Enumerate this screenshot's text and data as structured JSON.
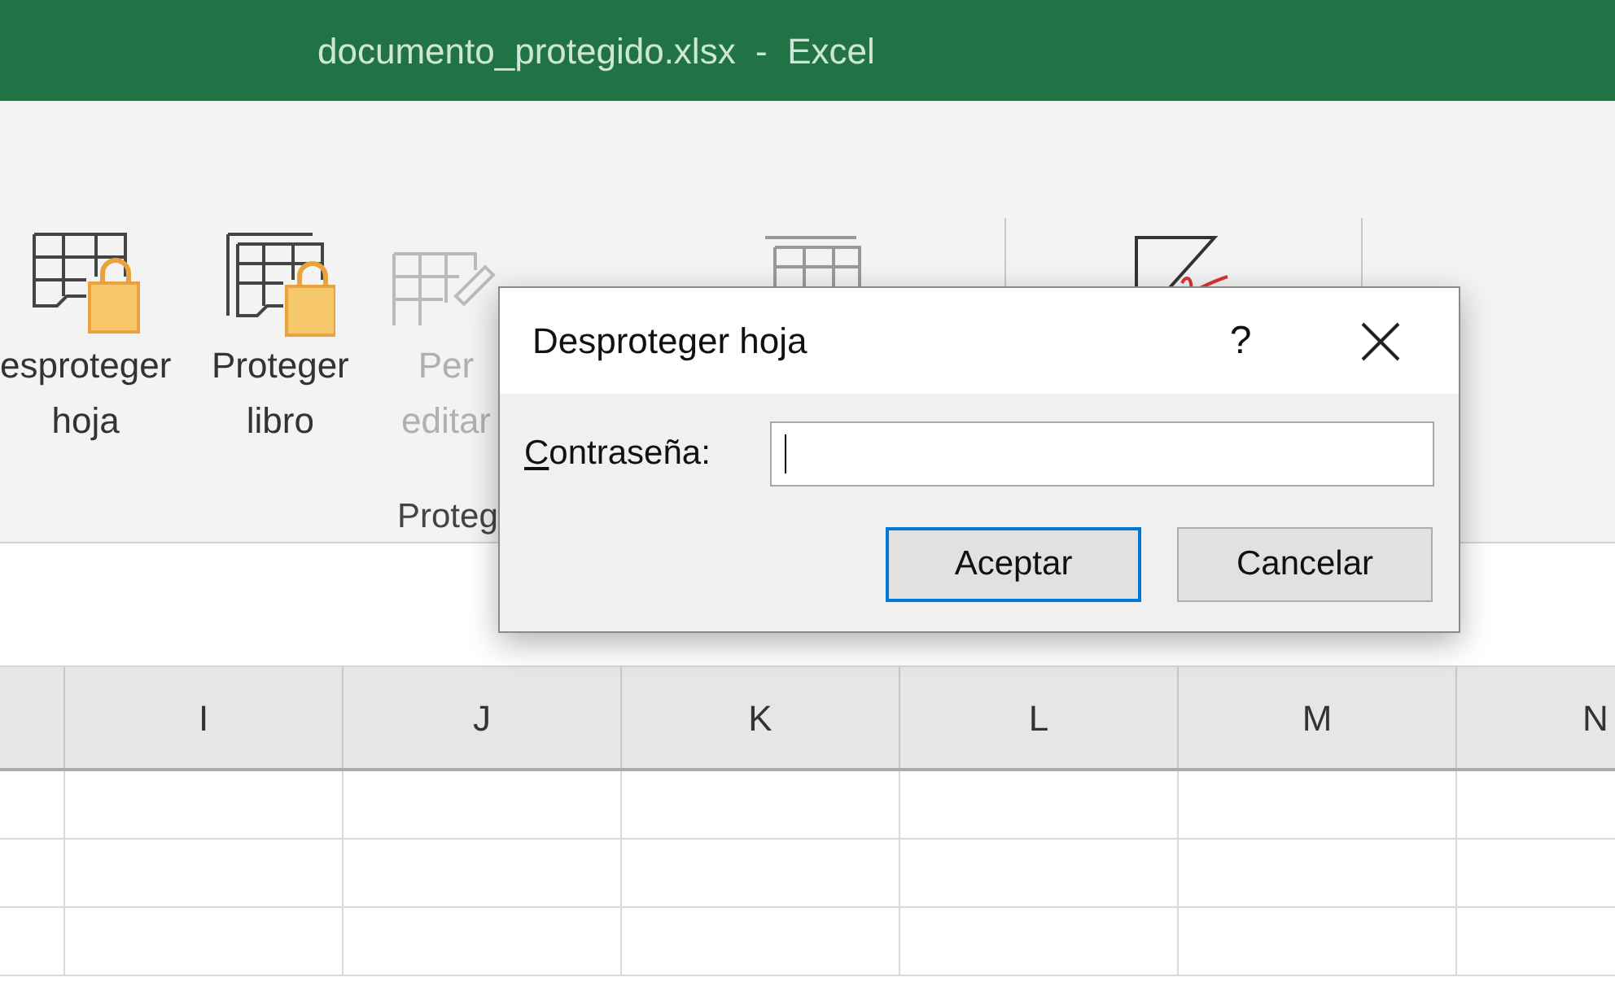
{
  "title_bar": {
    "title": "documento_protegido.xlsx  -  Excel"
  },
  "ribbon": {
    "buttons": [
      {
        "kind": "sheet-lock",
        "lines": [
          "esproteger",
          "hoja"
        ],
        "disabled": false
      },
      {
        "kind": "book-lock",
        "lines": [
          "Proteger",
          "libro"
        ],
        "disabled": false
      },
      {
        "kind": "ranges",
        "lines": [
          "Per",
          "editar"
        ],
        "disabled": true
      }
    ],
    "group_label": "Proteg"
  },
  "dialog": {
    "title": "Desproteger hoja",
    "help": "?",
    "field_label": "Contraseña:",
    "buttons": [
      {
        "label": "Aceptar",
        "default": true
      },
      {
        "label": "Cancelar",
        "default": false
      }
    ]
  },
  "sheet": {
    "columns": [
      "I",
      "J",
      "K",
      "L",
      "M",
      "N"
    ]
  }
}
